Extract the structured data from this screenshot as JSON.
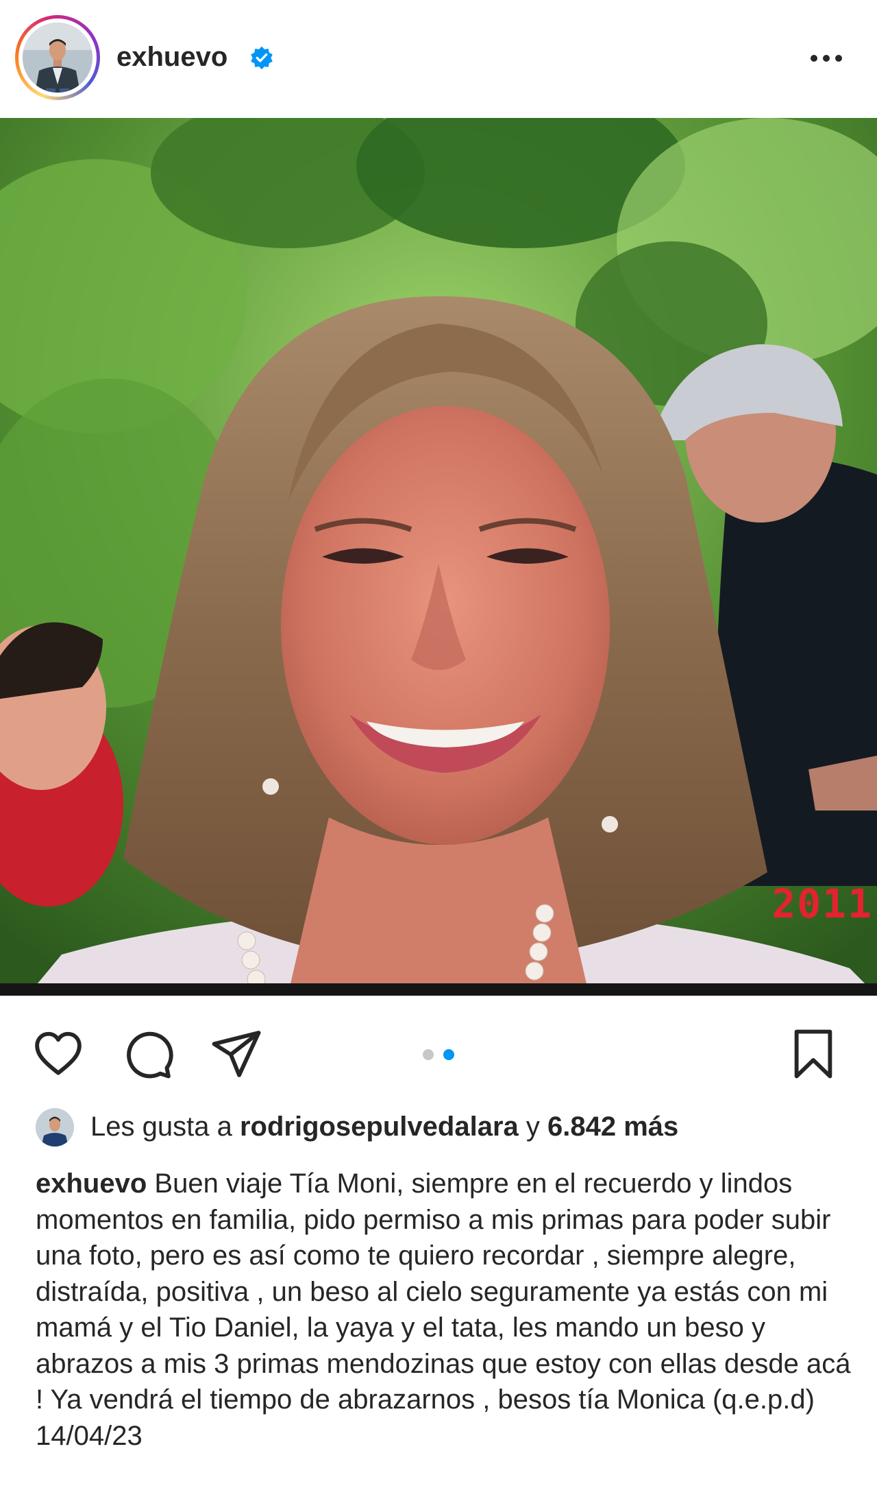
{
  "post": {
    "username": "exhuevo",
    "verified": true,
    "accent_color": "#0095f6",
    "photo_date_stamp": "2011",
    "carousel": {
      "count": 2,
      "active_index": 1
    },
    "icons": {
      "verified": "verified-badge-icon",
      "more": "more-horizontal-icon",
      "like": "heart-icon",
      "comment": "comment-icon",
      "share": "paper-plane-icon",
      "save": "bookmark-icon"
    },
    "likes": {
      "prefix": "Les gusta a",
      "liker": "rodrigosepulvedalara",
      "connector": "y",
      "others": "6.842 más"
    },
    "caption": {
      "username": "exhuevo",
      "text": "Buen viaje Tía Moni, siempre en el recuerdo y lindos momentos en familia, pido permiso a mis primas para poder subir una foto, pero es así como te quiero recordar , siempre alegre, distraída, positiva , un beso al cielo seguramente ya estás con mi mamá y el Tio Daniel, la yaya y el tata, les mando un beso y abrazos a mis 3 primas mendozinas que estoy con ellas desde acá ! Ya vendrá el tiempo de abrazarnos , besos tía Monica (q.e.p.d) 14/04/23"
    }
  }
}
